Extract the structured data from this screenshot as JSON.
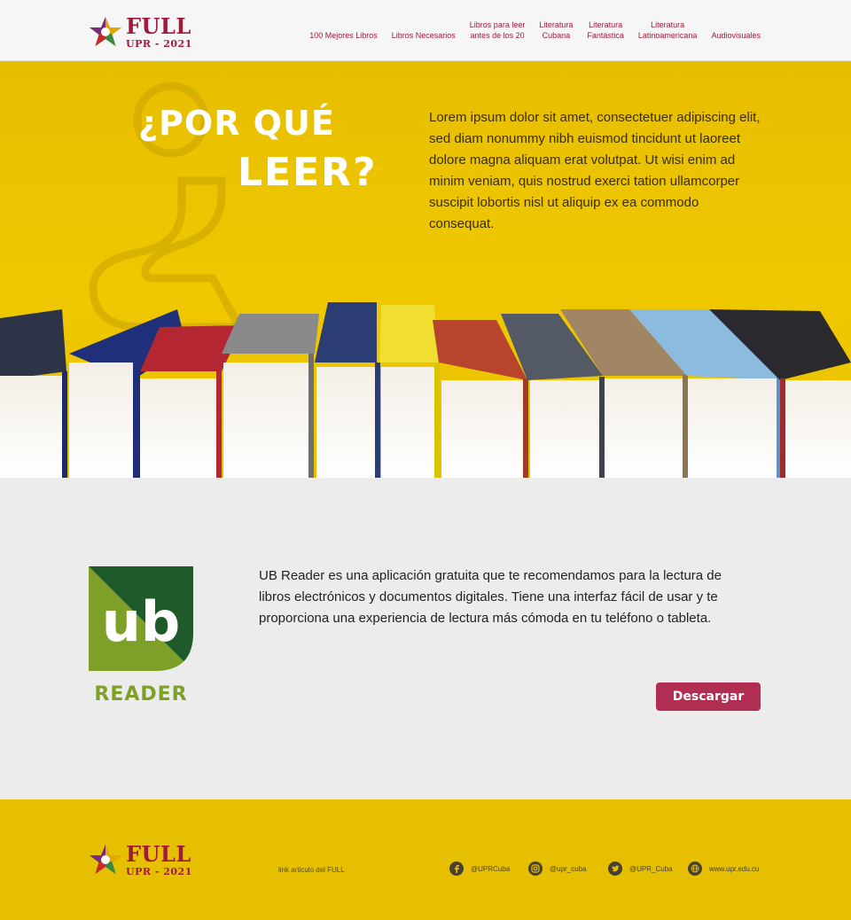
{
  "brand": {
    "name": "FULL",
    "subtitle": "UPR - 2021"
  },
  "nav": {
    "items": [
      {
        "label": "100 Mejores Libros"
      },
      {
        "label": "Libros Necesarios"
      },
      {
        "label": "Libros para leer\nantes de los 20"
      },
      {
        "label": "Literatura\nCubana"
      },
      {
        "label": "Literatura\nFantástica"
      },
      {
        "label": "Literatura\nLatinoamericana"
      },
      {
        "label": "Audiovisuales"
      }
    ]
  },
  "hero": {
    "title_line1": "¿POR QUÉ",
    "title_line2": "LEER?",
    "paragraph": "Lorem ipsum dolor sit amet, consectetuer adipiscing elit, sed diam nonummy nibh euismod tincidunt ut laoreet dolore magna aliquam erat volutpat. Ut wisi enim ad minim veniam, quis nostrud exerci tation ullamcorper suscipit lobortis nisl ut aliquip ex ea commodo consequat."
  },
  "ub_reader": {
    "logo_text": "ub",
    "caption": "READER",
    "description": "UB Reader es una aplicación gratuita que te recomendamos para la lectura de libros electrónicos y documentos digitales. Tiene una interfaz fácil de usar y te proporciona una experiencia de lectura más cómoda en tu teléfono o tableta.",
    "button_label": "Descargar"
  },
  "footer": {
    "link_text": "link articulo del FULL",
    "social": [
      {
        "icon": "facebook-icon",
        "label": "@UPRCuba"
      },
      {
        "icon": "instagram-icon",
        "label": "@upr_cuba"
      },
      {
        "icon": "twitter-icon",
        "label": "@UPR_Cuba"
      },
      {
        "icon": "globe-icon",
        "label": "www.upr.edu.cu"
      }
    ]
  },
  "colors": {
    "brand_red": "#9e1b3a",
    "hero_yellow": "#f0c800",
    "button": "#b02e52",
    "ub_green": "#7ea028"
  }
}
